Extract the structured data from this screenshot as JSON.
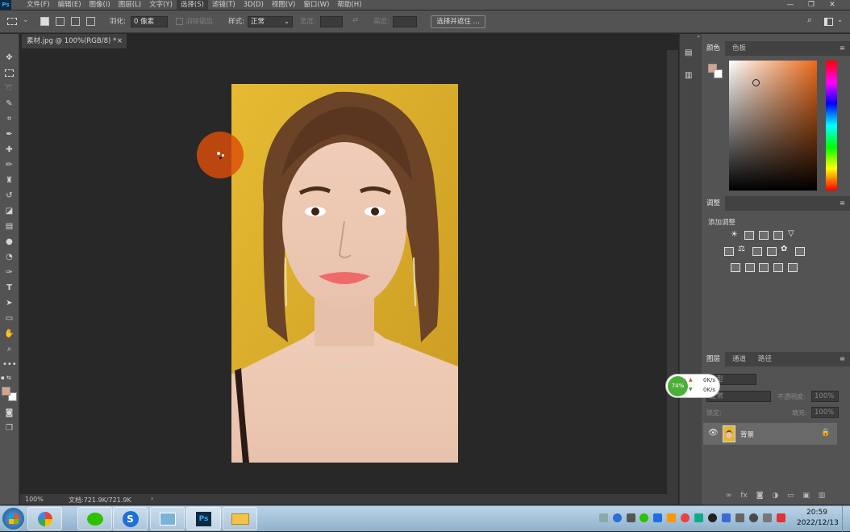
{
  "app": {
    "logo": "Ps"
  },
  "menu": {
    "items": [
      "文件(F)",
      "编辑(E)",
      "图像(I)",
      "图层(L)",
      "文字(Y)",
      "选择(S)",
      "滤镜(T)",
      "3D(D)",
      "视图(V)",
      "窗口(W)",
      "帮助(H)"
    ],
    "active_index": 5
  },
  "window_controls": {
    "minimize": "—",
    "restore": "❐",
    "close": "✕"
  },
  "options": {
    "feather_label": "羽化:",
    "feather_value": "0 像素",
    "antialias_label": "消除锯齿",
    "style_label": "样式:",
    "style_value": "正常",
    "width_label": "宽度:",
    "height_label": "高度:",
    "select_mask_button": "选择并遮住 ..."
  },
  "document": {
    "tab_title": "素材.jpg @ 100%(RGB/8) *",
    "tab_close": "×"
  },
  "status": {
    "zoom": "100%",
    "doc_info": "文档:721.9K/721.9K",
    "arrow": "›"
  },
  "panels": {
    "color": {
      "tabs": [
        "颜色",
        "色板"
      ],
      "foreground": "#d4a48e",
      "background": "#ffffff"
    },
    "adjustments": {
      "title": "调整",
      "add_label": "添加调整"
    },
    "layers": {
      "tabs": [
        "图层",
        "通道",
        "路径"
      ],
      "kind_label": "类型",
      "blend_mode": "正常",
      "opacity_label": "不透明度:",
      "opacity_value": "100%",
      "lock_label": "锁定:",
      "fill_label": "填充:",
      "fill_value": "100%",
      "layer_name": "背景"
    }
  },
  "net_widget": {
    "percent": "74%",
    "up": "0K/s",
    "down": "0K/s"
  },
  "taskbar": {
    "time": "20:59",
    "date": "2022/12/13",
    "apps": [
      "Windows",
      "Google",
      "WeChat",
      "Sogou",
      "Files",
      "Photoshop",
      "Explorer"
    ]
  },
  "colors": {
    "accent": "#dc4e0a",
    "photo_bg": "#e3b72e",
    "ps_blue": "#31a8ff"
  }
}
